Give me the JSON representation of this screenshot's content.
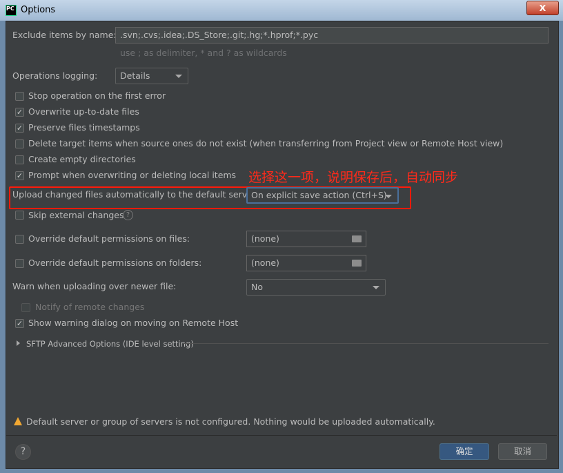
{
  "window": {
    "title": "Options",
    "app_icon": "PC"
  },
  "exclude": {
    "label": "Exclude items by name:",
    "value": ".svn;.cvs;.idea;.DS_Store;.git;.hg;*.hprof;*.pyc",
    "hint": "use ; as delimiter, * and ? as wildcards"
  },
  "logging": {
    "label": "Operations logging:",
    "value": "Details"
  },
  "checks": [
    {
      "label": "Stop operation on the first error",
      "checked": false
    },
    {
      "label": "Overwrite up-to-date files",
      "checked": true
    },
    {
      "label": "Preserve files timestamps",
      "checked": true
    },
    {
      "label": "Delete target items when source ones do not exist (when transferring from Project view or Remote Host view)",
      "checked": false
    },
    {
      "label": "Create empty directories",
      "checked": false
    },
    {
      "label": "Prompt when overwriting or deleting local items",
      "checked": true
    }
  ],
  "upload": {
    "label": "Upload changed files automatically to the default server",
    "value": "On explicit save action (Ctrl+S)"
  },
  "annotation": "选择这一项，说明保存后，自动同步",
  "skip_external": {
    "label": "Skip external changes",
    "checked": false
  },
  "perm_files": {
    "label": "Override default permissions on files:",
    "value": "(none)",
    "checked": false
  },
  "perm_folders": {
    "label": "Override default permissions on folders:",
    "value": "(none)",
    "checked": false
  },
  "warn": {
    "label": "Warn when uploading over newer file:",
    "value": "No"
  },
  "notify": {
    "label": "Notify of remote changes",
    "checked": false,
    "disabled": true
  },
  "show_warning": {
    "label": "Show warning dialog on moving on Remote Host",
    "checked": true
  },
  "sftp": {
    "label": "SFTP Advanced Options (IDE level setting)"
  },
  "warning_msg": "Default server or group of servers is not configured. Nothing would be uploaded automatically.",
  "buttons": {
    "ok": "确定",
    "cancel": "取消",
    "help": "?",
    "close": "X"
  },
  "colors": {
    "bg": "#3c3f41",
    "accent": "#365880",
    "annotation": "#ff2a1a"
  }
}
